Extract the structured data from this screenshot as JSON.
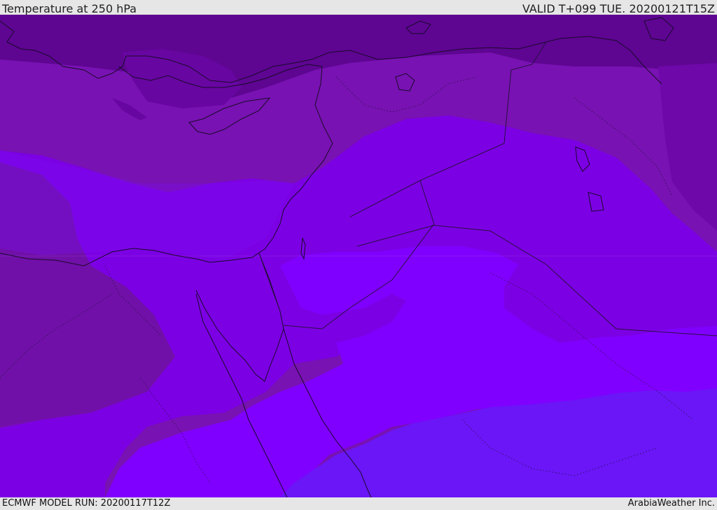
{
  "header": {
    "title": "Temperature at 250 hPa",
    "valid": "VALID T+099 TUE. 20200121T15Z"
  },
  "footer": {
    "model_run": "ECMWF MODEL RUN: 20200117T12Z",
    "credit": "ArabiaWeather Inc."
  },
  "map": {
    "field": "temperature",
    "level": "250 hPa",
    "colors": {
      "band_darkest": "#5e0592",
      "band_dark": "#6806a2",
      "band_mid": "#7812b2",
      "band_violet": "#7c00e4",
      "band_bright": "#8000ff",
      "band_blue": "#6a16f7",
      "coast": "#1a0a2a",
      "borders": "#2a1040"
    }
  }
}
